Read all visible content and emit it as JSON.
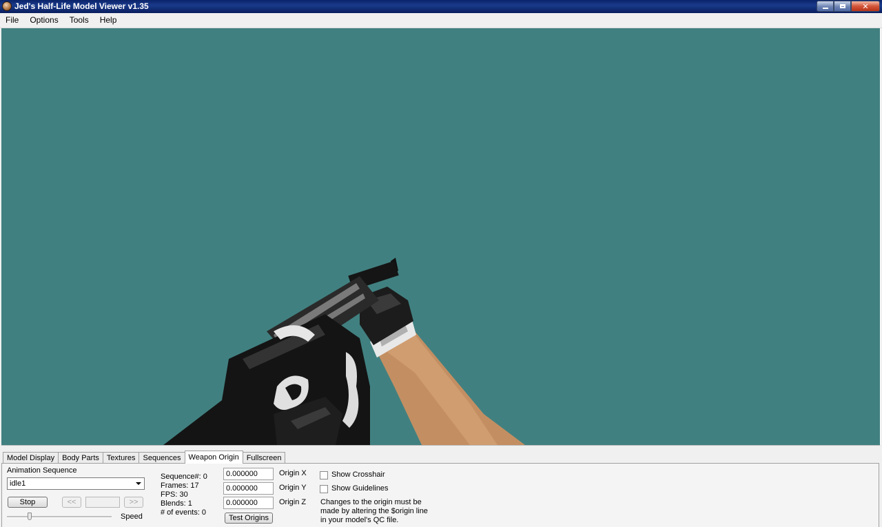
{
  "window": {
    "title": "Jed's Half-Life Model Viewer v1.35",
    "accent": "#0a246a"
  },
  "menu": [
    "File",
    "Options",
    "Tools",
    "Help"
  ],
  "viewport": {
    "background": "#418080"
  },
  "tabs": [
    {
      "label": "Model Display",
      "active": false
    },
    {
      "label": "Body Parts",
      "active": false
    },
    {
      "label": "Textures",
      "active": false
    },
    {
      "label": "Sequences",
      "active": false
    },
    {
      "label": "Weapon Origin",
      "active": true
    },
    {
      "label": "Fullscreen",
      "active": false
    }
  ],
  "animation": {
    "label": "Animation Sequence",
    "selected": "idle1",
    "stop_label": "Stop",
    "prev_label": "<<",
    "next_label": ">>",
    "speed_label": "Speed"
  },
  "sequence_info": {
    "sequence": "Sequence#: 0",
    "frames": "Frames: 17",
    "fps": "FPS: 30",
    "blends": "Blends: 1",
    "events": "# of events: 0"
  },
  "origin": {
    "x_value": "0.000000",
    "y_value": "0.000000",
    "z_value": "0.000000",
    "x_label": "Origin X",
    "y_label": "Origin Y",
    "z_label": "Origin Z",
    "test_label": "Test Origins"
  },
  "options": {
    "crosshair_label": "Show Crosshair",
    "guidelines_label": "Show Guidelines",
    "note_line1": "Changes to the origin must be",
    "note_line2": "made by altering the $origin line",
    "note_line3": "in your model's QC file."
  }
}
